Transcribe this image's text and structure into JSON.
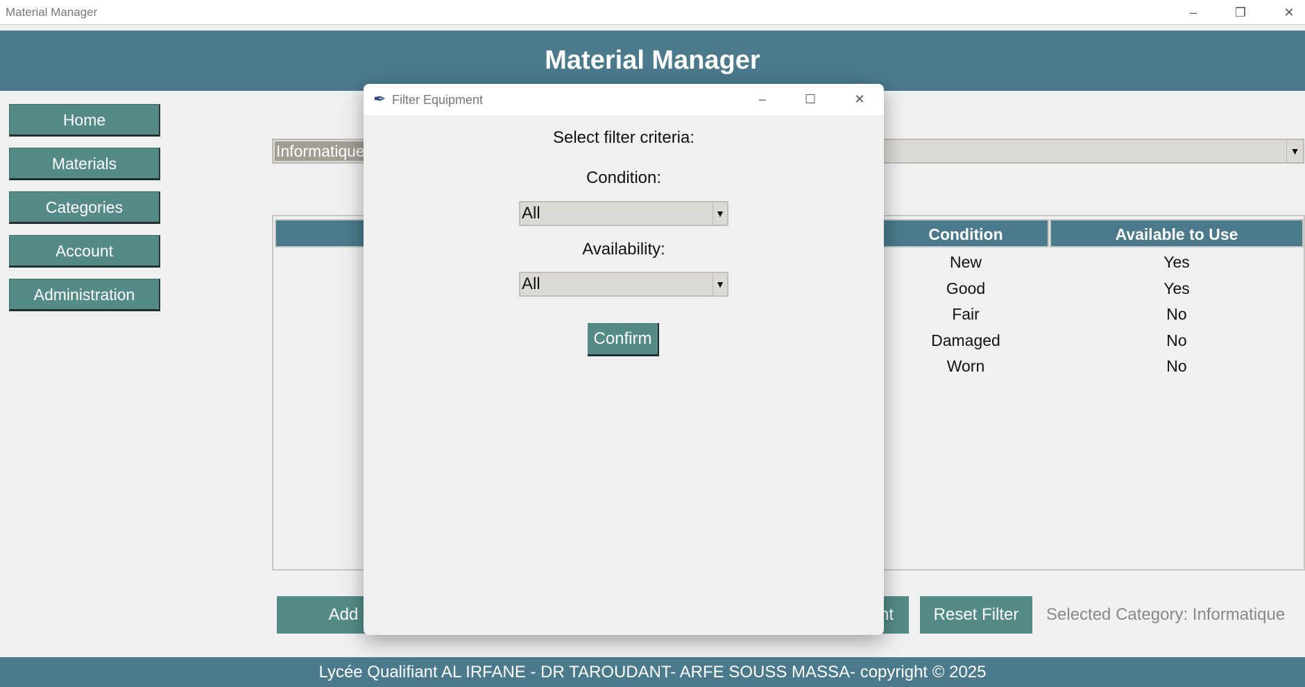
{
  "window": {
    "title": "Material Manager",
    "controls": {
      "minimize": "–",
      "maximize": "❐",
      "close": "✕"
    }
  },
  "header": {
    "title": "Material Manager"
  },
  "sidebar": {
    "items": [
      {
        "label": "Home"
      },
      {
        "label": "Materials"
      },
      {
        "label": "Categories"
      },
      {
        "label": "Account"
      },
      {
        "label": "Administration"
      }
    ]
  },
  "category_select": {
    "value": "Informatique",
    "arrow": "▼"
  },
  "table": {
    "columns": [
      "Condition",
      "Available to Use"
    ],
    "rows": [
      [
        "New",
        "Yes"
      ],
      [
        "Good",
        "Yes"
      ],
      [
        "Fair",
        "No"
      ],
      [
        "Damaged",
        "No"
      ],
      [
        "Worn",
        "No"
      ]
    ]
  },
  "actions": {
    "add_label": "Add Equip",
    "second_label": "nt",
    "reset_label": "Reset Filter",
    "selected_category": "Selected Category: Informatique"
  },
  "footer": {
    "text": "Lycée Qualifiant AL IRFANE - DR TAROUDANT- ARFE SOUSS MASSA-  copyright © 2025"
  },
  "dialog": {
    "title": "Filter Equipment",
    "controls": {
      "minimize": "–",
      "maximize": "☐",
      "close": "✕"
    },
    "prompt": "Select filter criteria:",
    "condition_label": "Condition:",
    "condition_value": "All",
    "availability_label": "Availability:",
    "availability_value": "All",
    "arrow": "▼",
    "confirm_label": "Confirm"
  },
  "colors": {
    "header": "#4a7a8c",
    "button": "#548b87",
    "background": "#f0f0f0"
  }
}
